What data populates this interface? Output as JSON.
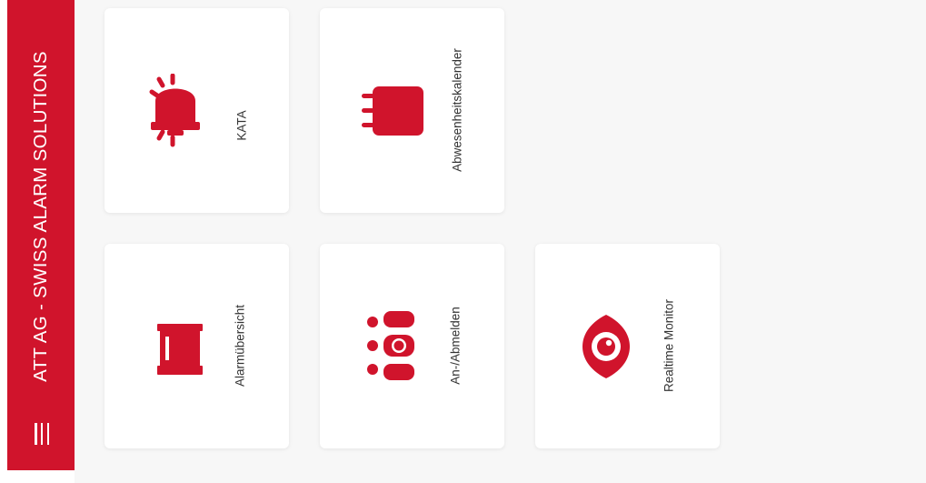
{
  "app": {
    "title": "ATT AG - SWISS ALARM SOLUTIONS",
    "brand_color": "#d0142c",
    "menu_icon": "hamburger-menu-icon"
  },
  "tiles": [
    {
      "label": "KATA",
      "icon": "bell-alarm-icon"
    },
    {
      "label": "Abwesenheitskalender",
      "icon": "calendar-icon"
    },
    {
      "label": "Alarmübersicht",
      "icon": "alarm-light-icon"
    },
    {
      "label": "An-/Abmelden",
      "icon": "team-people-icon"
    },
    {
      "label": "Realtime Monitor",
      "icon": "eye-monitor-icon"
    }
  ]
}
